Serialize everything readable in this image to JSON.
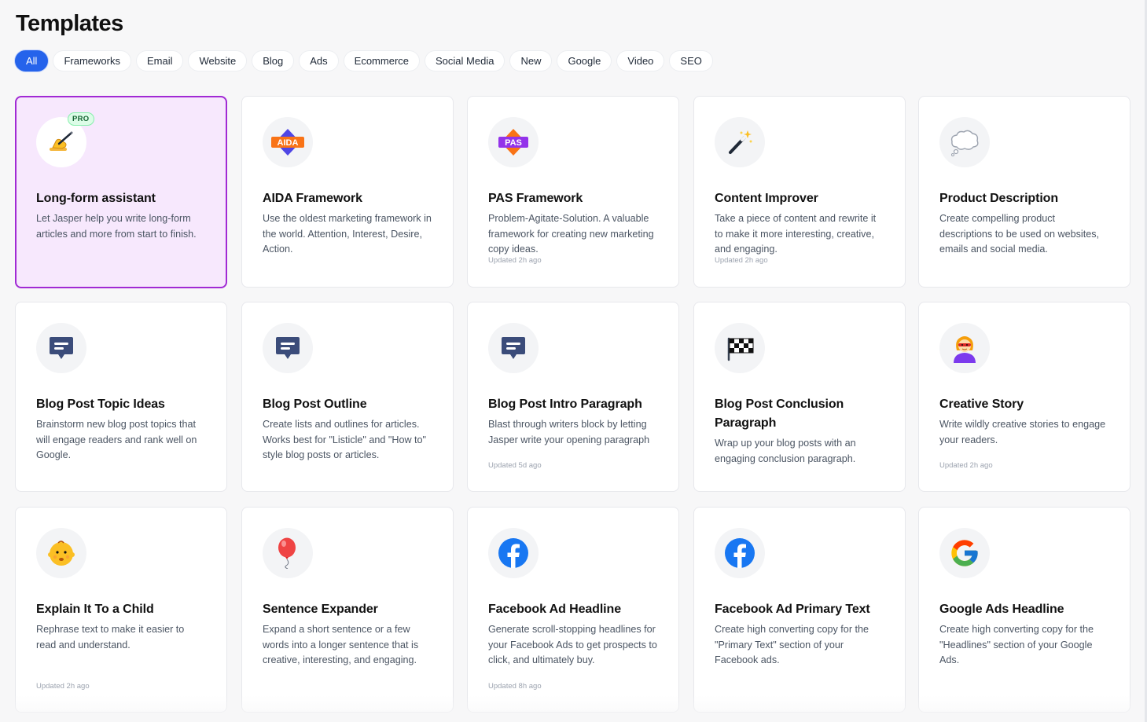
{
  "page": {
    "title": "Templates"
  },
  "tabs": [
    {
      "label": "All",
      "active": true
    },
    {
      "label": "Frameworks"
    },
    {
      "label": "Email"
    },
    {
      "label": "Website"
    },
    {
      "label": "Blog"
    },
    {
      "label": "Ads"
    },
    {
      "label": "Ecommerce"
    },
    {
      "label": "Social Media"
    },
    {
      "label": "New"
    },
    {
      "label": "Google"
    },
    {
      "label": "Video"
    },
    {
      "label": "SEO"
    }
  ],
  "colors": {
    "accent": "#2563eb",
    "selected_border": "#a12ad4",
    "selected_bg": "#f7e8fd",
    "pro_badge": "#dcfce7"
  },
  "cards": [
    {
      "icon": "writing-hand-icon",
      "title": "Long-form assistant",
      "desc": "Let Jasper help you write long-form articles and more from start to finish.",
      "badge": "PRO",
      "updated": ""
    },
    {
      "icon": "aida-icon",
      "icon_text": "AIDA",
      "title": "AIDA Framework",
      "desc": "Use the oldest marketing framework in the world. Attention, Interest, Desire, Action.",
      "updated": ""
    },
    {
      "icon": "pas-icon",
      "icon_text": "PAS",
      "title": "PAS Framework",
      "desc": "Problem-Agitate-Solution. A valuable framework for creating new marketing copy ideas.",
      "updated": "Updated 2h ago"
    },
    {
      "icon": "magic-wand-icon",
      "title": "Content Improver",
      "desc": "Take a piece of content and rewrite it to make it more interesting, creative, and engaging.",
      "updated": "Updated 2h ago"
    },
    {
      "icon": "thought-bubble-icon",
      "title": "Product Description",
      "desc": "Create compelling product descriptions to be used on websites, emails and social media.",
      "updated": ""
    },
    {
      "icon": "chat-bubble-icon",
      "title": "Blog Post Topic Ideas",
      "desc": "Brainstorm new blog post topics that will engage readers and rank well on Google.",
      "updated": ""
    },
    {
      "icon": "chat-bubble-icon",
      "title": "Blog Post Outline",
      "desc": "Create lists and outlines for articles. Works best for \"Listicle\" and \"How to\" style blog posts or articles.",
      "updated": ""
    },
    {
      "icon": "chat-bubble-icon",
      "title": "Blog Post Intro Paragraph",
      "desc": "Blast through writers block by letting Jasper write your opening paragraph",
      "updated": "Updated 5d ago"
    },
    {
      "icon": "checkered-flag-icon",
      "title": "Blog Post Conclusion Paragraph",
      "desc": "Wrap up your blog posts with an engaging conclusion paragraph.",
      "updated": ""
    },
    {
      "icon": "superhero-icon",
      "title": "Creative Story",
      "desc": "Write wildly creative stories to engage your readers.",
      "updated": "Updated 2h ago"
    },
    {
      "icon": "baby-icon",
      "title": "Explain It To a Child",
      "desc": "Rephrase text to make it easier to read and understand.",
      "updated": "Updated 2h ago"
    },
    {
      "icon": "balloon-icon",
      "title": "Sentence Expander",
      "desc": "Expand a short sentence or a few words into a longer sentence that is creative, interesting, and engaging.",
      "updated": ""
    },
    {
      "icon": "facebook-icon",
      "title": "Facebook Ad Headline",
      "desc": "Generate scroll-stopping headlines for your Facebook Ads to get prospects to click, and ultimately buy.",
      "updated": "Updated 8h ago"
    },
    {
      "icon": "facebook-icon",
      "title": "Facebook Ad Primary Text",
      "desc": "Create high converting copy for the \"Primary Text\" section of your Facebook ads.",
      "updated": ""
    },
    {
      "icon": "google-icon",
      "title": "Google Ads Headline",
      "desc": "Create high converting copy for the \"Headlines\" section of your Google Ads.",
      "updated": ""
    }
  ]
}
